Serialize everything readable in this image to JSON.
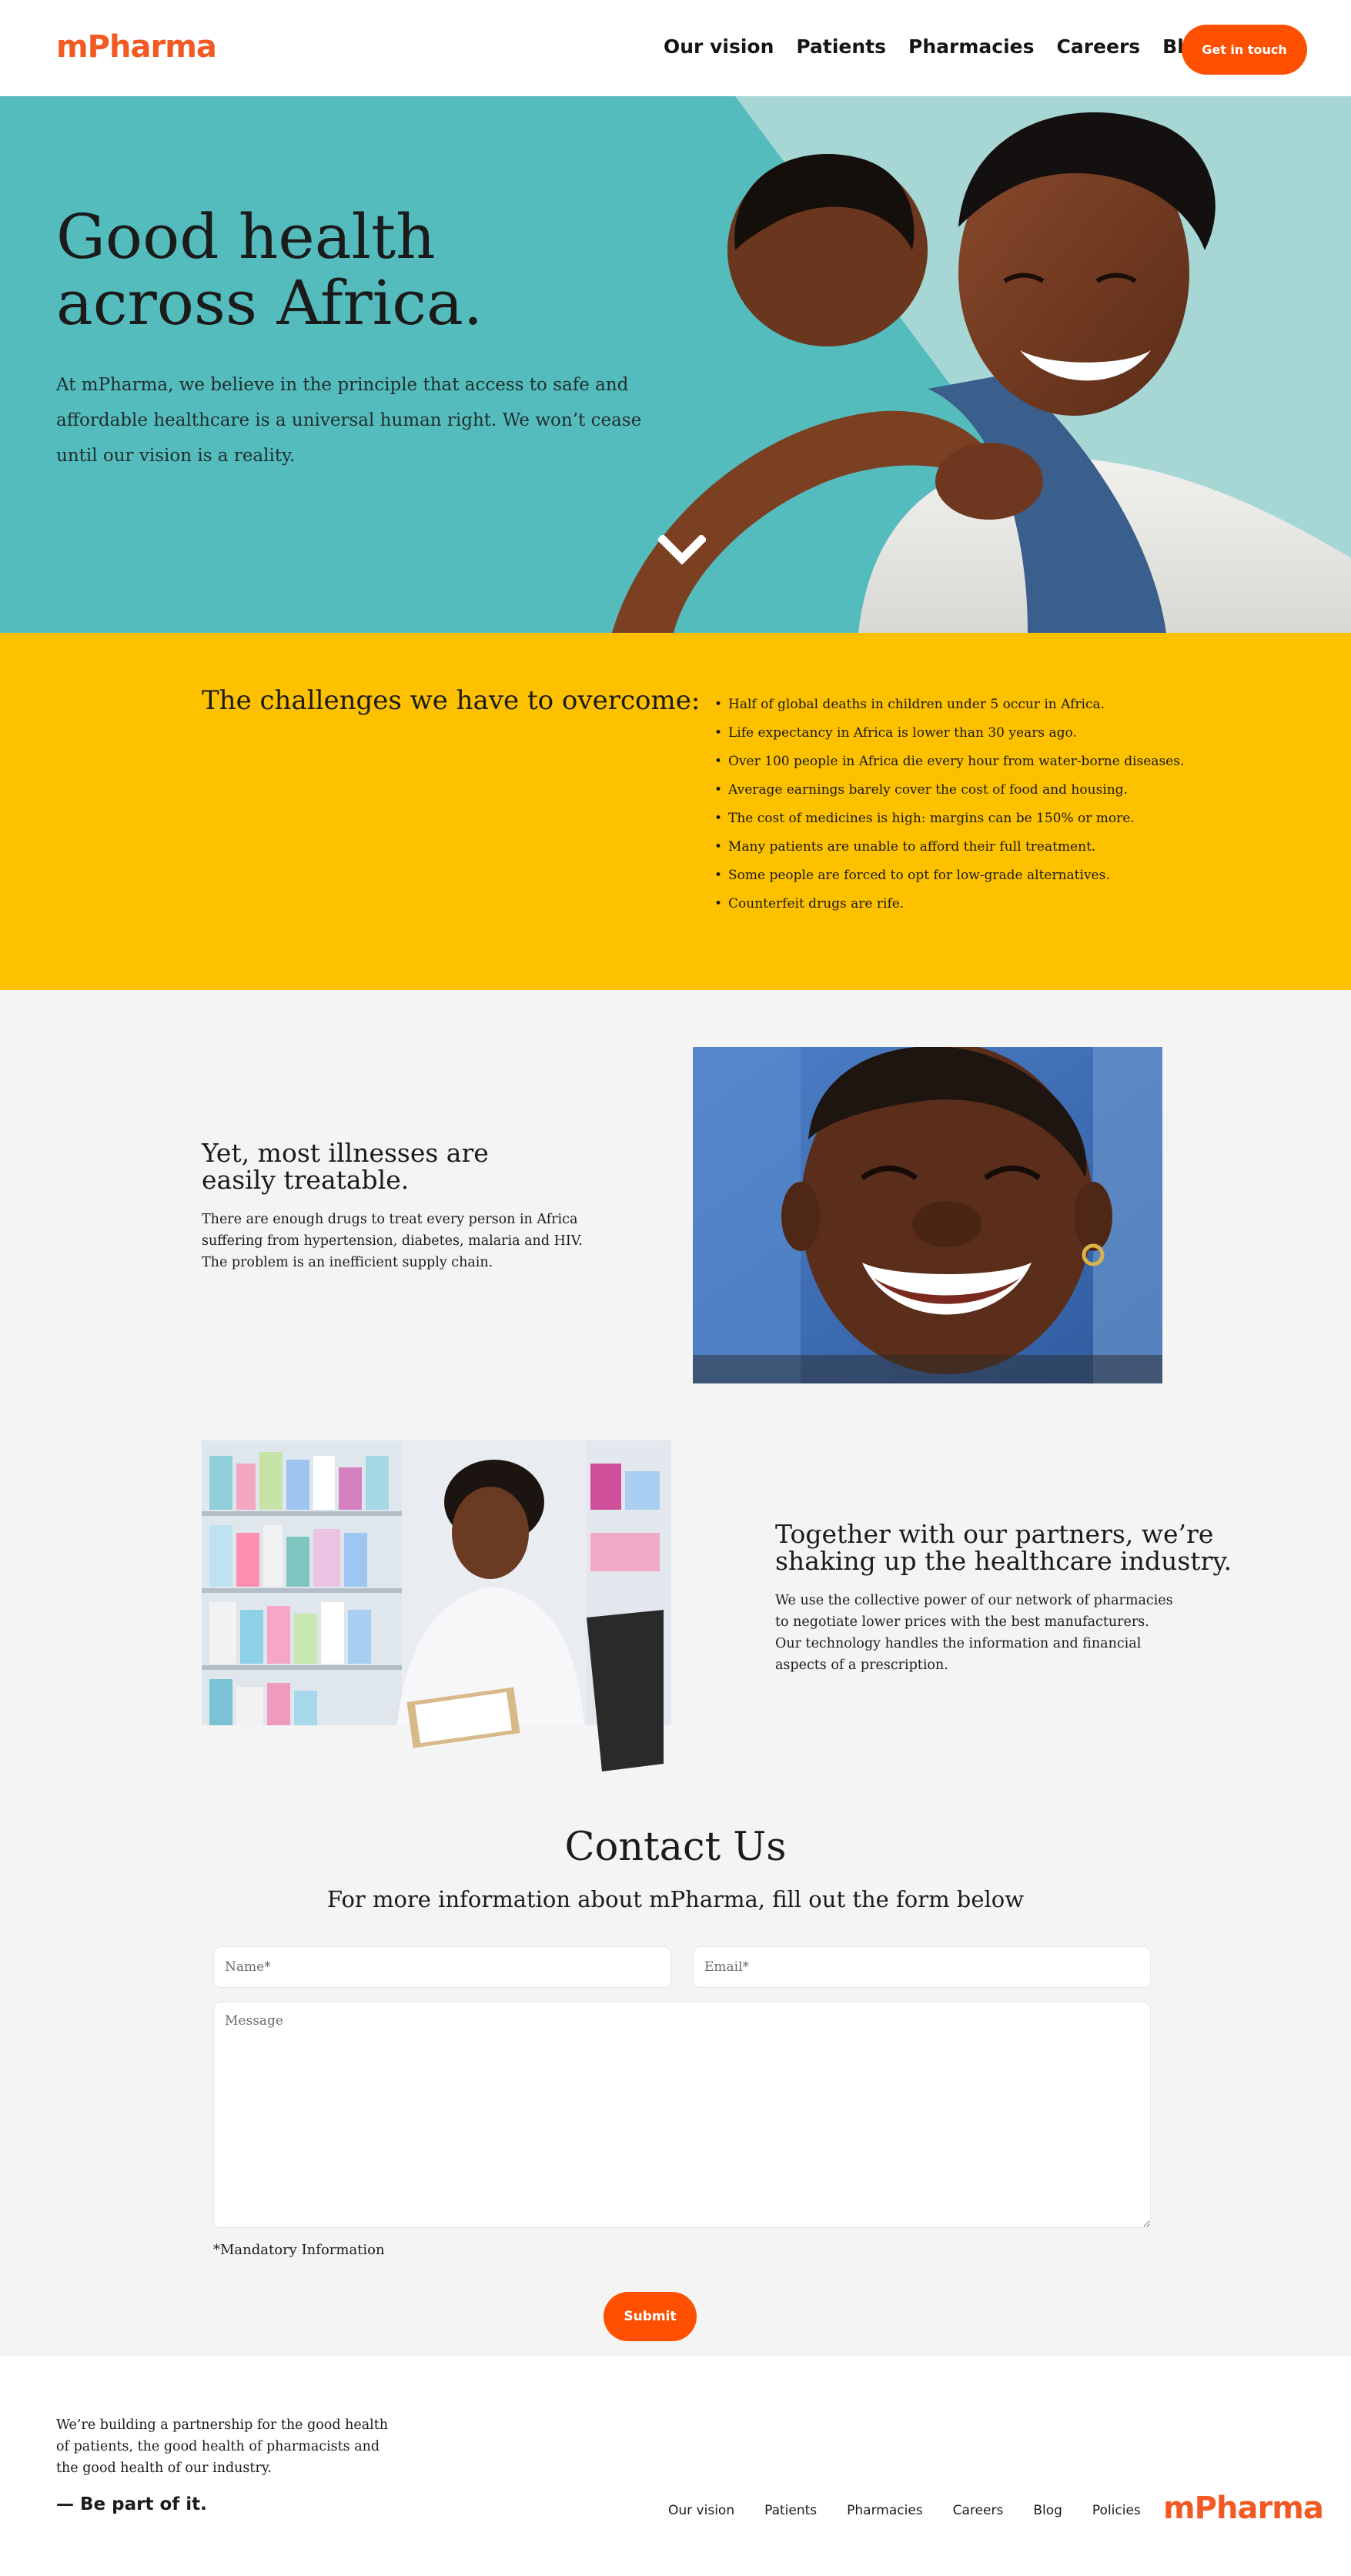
{
  "header": {
    "logo": "mPharma",
    "nav": [
      "Our vision",
      "Patients",
      "Pharmacies",
      "Careers",
      "Blog"
    ],
    "cta": "Get in touch"
  },
  "hero": {
    "title_line1": "Good health",
    "title_line2": "across Africa.",
    "text": "At mPharma, we believe in the principle that access to safe and affordable healthcare is a universal human right. We won’t cease until our vision is a reality."
  },
  "challenges": {
    "title": "The challenges we have to overcome:",
    "items": [
      "Half of global deaths in children under 5 occur in Africa.",
      "Life expectancy in Africa is lower than 30 years ago.",
      "Over 100 people in Africa die every hour from water-borne diseases.",
      "Average earnings barely cover the cost of food and housing.",
      "The cost of medicines is high: margins can be 150% or more.",
      "Many patients are unable to afford their full treatment.",
      "Some people are forced to opt for low-grade alternatives.",
      "Counterfeit drugs are rife."
    ]
  },
  "features": [
    {
      "title_line1": "Yet, most illnesses are",
      "title_line2": "easily treatable.",
      "text": "There are enough drugs to treat every person in Africa suffering from hypertension, diabetes, malaria and HIV. The problem is an inefficient supply chain."
    },
    {
      "title_line1": "Together with our partners, we’re",
      "title_line2": "shaking up the healthcare industry.",
      "text": "We use the collective power of our network of pharmacies to negotiate lower prices with the best manufacturers. Our technology handles the information and financial aspects of a prescription."
    }
  ],
  "contact": {
    "title": "Contact Us",
    "subtitle": "For more information about mPharma, fill out the form below",
    "name_placeholder": "Name*",
    "email_placeholder": "Email*",
    "message_placeholder": "Message",
    "mandatory": "*Mandatory Information",
    "submit": "Submit"
  },
  "footer": {
    "text": "We’re building a partnership for the good health of patients, the good health of pharmacists and the good health of our industry.",
    "tagline": "— Be part of it.",
    "nav": [
      "Our vision",
      "Patients",
      "Pharmacies",
      "Careers",
      "Blog",
      "Policies"
    ],
    "logo": "mPharma"
  },
  "colors": {
    "brand_orange": "#fe5000",
    "hero_teal": "#55bcbd",
    "challenges_yellow": "#fdc100",
    "page_bg": "#f4f4f4"
  }
}
